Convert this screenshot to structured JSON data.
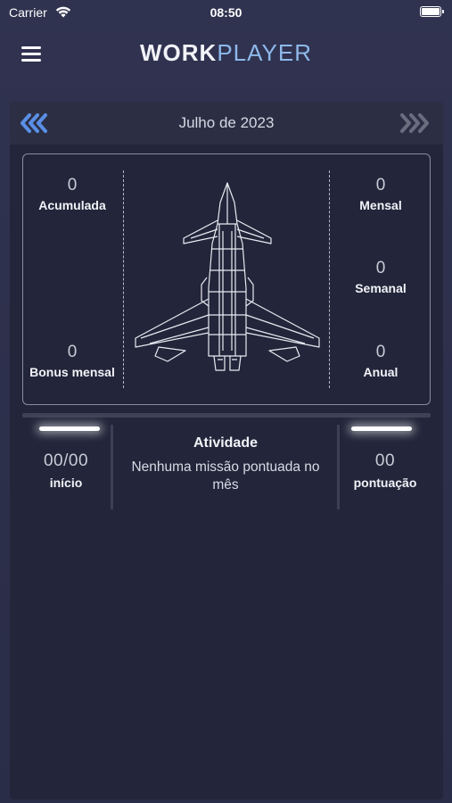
{
  "status_bar": {
    "carrier": "Carrier",
    "time": "08:50"
  },
  "header": {
    "logo_work": "WORK",
    "logo_player": "PLAYER"
  },
  "month": {
    "title": "Julho de 2023"
  },
  "stats": {
    "acumulada": {
      "value": "0",
      "label": "Acumulada"
    },
    "bonus_mensal": {
      "value": "0",
      "label": "Bonus mensal"
    },
    "mensal": {
      "value": "0",
      "label": "Mensal"
    },
    "semanal": {
      "value": "0",
      "label": "Semanal"
    },
    "anual": {
      "value": "0",
      "label": "Anual"
    }
  },
  "bottom": {
    "inicio": {
      "value": "00/00",
      "label": "início"
    },
    "activity": {
      "title": "Atividade",
      "text": "Nenhuma missão pontuada no mês"
    },
    "pontuacao": {
      "value": "00",
      "label": "pontuação"
    }
  },
  "colors": {
    "accent": "#4f86e0",
    "background": "#2a2d47",
    "panel": "#23253a"
  }
}
